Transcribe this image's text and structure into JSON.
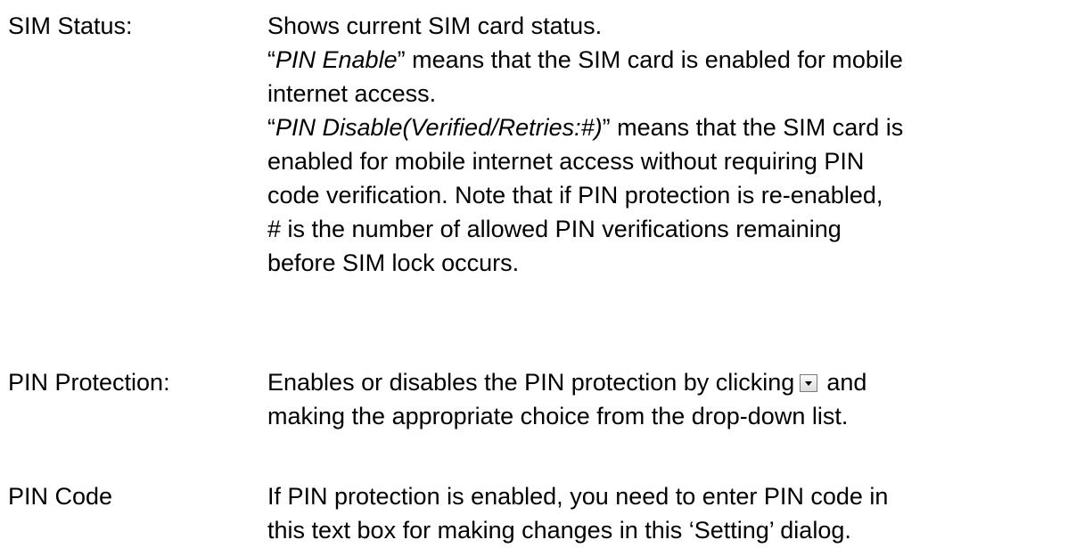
{
  "entries": [
    {
      "term": "SIM Status:",
      "lines": [
        "Shows current SIM card status.",
        {
          "q1": "“",
          "em": "PIN Enable",
          "q2": "”",
          "rest": " means that the SIM card is enabled for mobile"
        },
        "internet access.",
        {
          "q1": "“",
          "em": "PIN Disable(Verified/Retries:#)",
          "q2": "”",
          "rest": " means that the SIM card is"
        },
        "enabled for mobile internet access without requiring PIN",
        "code verification. Note that if PIN protection is re-enabled,",
        "# is the number of allowed PIN verifications remaining",
        "before SIM lock occurs."
      ]
    },
    {
      "term": "PIN Protection:",
      "lines": [
        {
          "before": "Enables or disables the PIN protection by clicking",
          "after": "and"
        },
        "making the appropriate choice from the drop-down list."
      ]
    },
    {
      "term": "PIN Code",
      "lines": [
        "If PIN protection is enabled, you need to enter PIN code in",
        "this text box for making changes in this ‘Setting’ dialog."
      ]
    }
  ],
  "icons": {
    "dropdown": "dropdown-arrow-icon"
  }
}
